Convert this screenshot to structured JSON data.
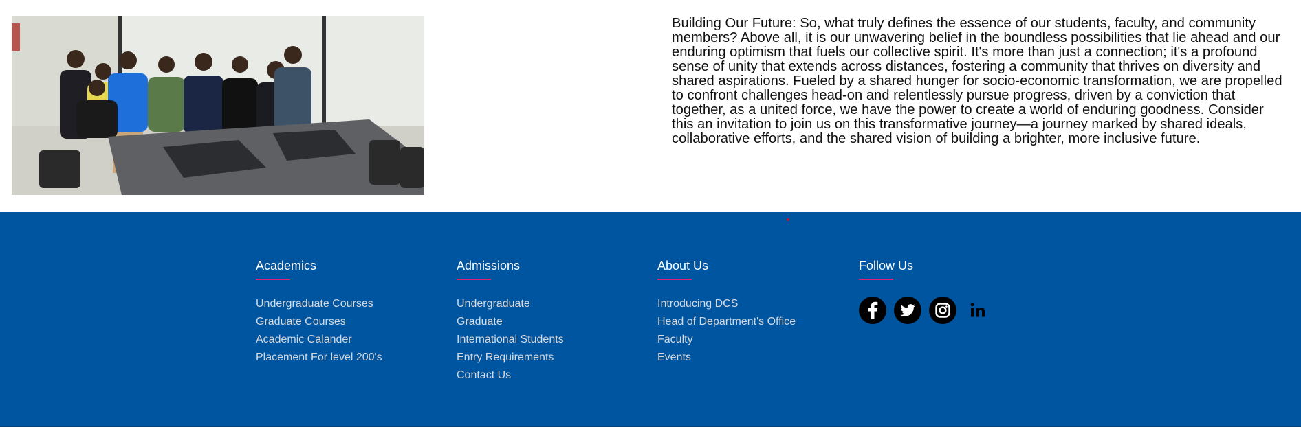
{
  "intro": {
    "photo_alt": "group-photo",
    "text": "Building Our Future: So, what truly defines the essence of our students, faculty, and community members? Above all, it is our unwavering belief in the boundless possibilities that lie ahead and our enduring optimism that fuels our collective spirit. It's more than just a connection; it's a profound sense of unity that extends across distances, fostering a community that thrives on diversity and shared aspirations. Fueled by a shared hunger for socio-economic transformation, we are propelled to confront challenges head-on and relentlessly pursue progress, driven by a conviction that together, as a united force, we have the power to create a world of enduring goodness. Consider this an invitation to join us on this transformative journey—a journey marked by shared ideals, collaborative efforts, and the shared vision of building a brighter, more inclusive future."
  },
  "footer": {
    "background": "#0055a1",
    "accent": "#e0237a",
    "academics": {
      "title": "Academics",
      "links": [
        "Undergraduate Courses",
        "Graduate Courses",
        "Academic Calander",
        "Placement For level 200's"
      ]
    },
    "admissions": {
      "title": "Admissions",
      "links": [
        "Undergraduate",
        "Graduate",
        "International Students",
        "Entry Requirements",
        "Contact Us"
      ]
    },
    "about": {
      "title": "About Us",
      "links": [
        "Introducing DCS",
        "Head of Department's Office",
        "Faculty",
        "Events"
      ]
    },
    "follow": {
      "title": "Follow Us",
      "icons": [
        "facebook-icon",
        "twitter-icon",
        "instagram-icon",
        "linkedin-icon"
      ]
    }
  }
}
